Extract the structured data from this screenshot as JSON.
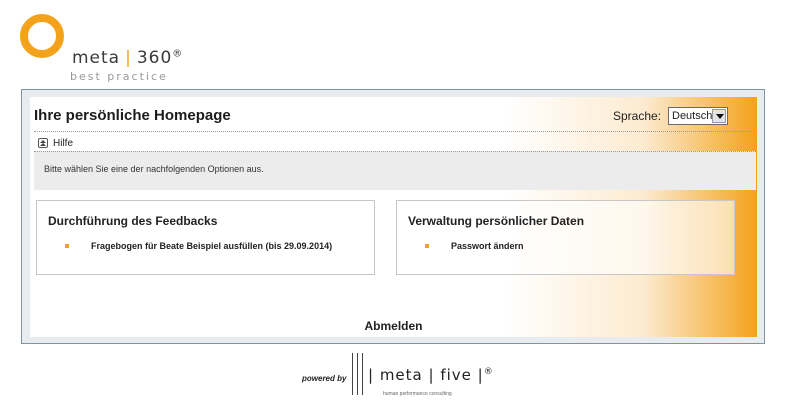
{
  "logo": {
    "brand": "meta",
    "separator": "|",
    "number": "360",
    "registered": "®",
    "subtitle": "best practice"
  },
  "header": {
    "title": "Ihre persönliche Homepage",
    "language_label": "Sprache:",
    "language_value": "Deutsch"
  },
  "help": {
    "label": "Hilfe"
  },
  "info": {
    "text": "Bitte wählen Sie eine der nachfolgenden Optionen aus."
  },
  "panels": [
    {
      "title": "Durchführung des Feedbacks",
      "items": [
        "Fragebogen für Beate Beispiel ausfüllen (bis 29.09.2014)"
      ]
    },
    {
      "title": "Verwaltung persönlicher Daten",
      "items": [
        "Passwort ändern"
      ]
    }
  ],
  "logout_label": "Abmelden",
  "footer": {
    "powered_by": "powered by",
    "brand_text": "| meta | five |",
    "registered": "®",
    "tagline": "human performance consulting"
  },
  "colors": {
    "accent": "#f4a21b",
    "frame_border": "#7d93a8",
    "frame_bg": "#e9ecef"
  }
}
